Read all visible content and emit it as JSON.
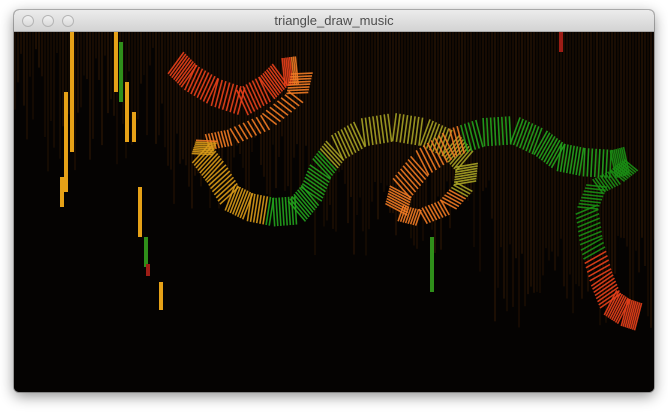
{
  "window": {
    "title": "triangle_draw_music",
    "controls": {
      "close": "close-button",
      "minimize": "minimize-button",
      "zoom": "zoom-button"
    }
  },
  "canvas": {
    "background_color": "#050302",
    "bar_color": "#1e0f03",
    "ribbon_colors": [
      "#e8401b",
      "#f07a24",
      "#d89a19",
      "#a7a225",
      "#6aa420",
      "#23a31d",
      "#1a8f14"
    ],
    "accent_colors": {
      "orange_bar": "#e6a117",
      "green_bar": "#2f8f1a",
      "red_marker": "#9e1d16"
    }
  }
}
